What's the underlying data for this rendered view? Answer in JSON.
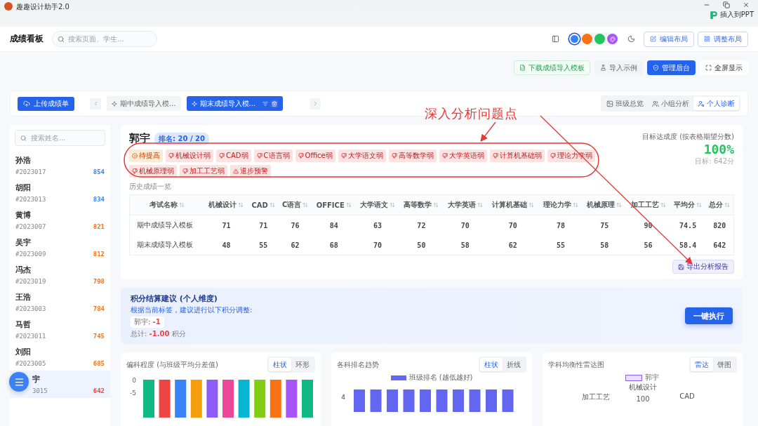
{
  "window": {
    "title": "趣趣设计助手2.0",
    "action": "插入到PPT"
  },
  "header": {
    "title": "成绩看板",
    "search": {
      "placeholder": "搜索页面、学生..."
    },
    "color_swatches": [
      {
        "color": "#3b82f6",
        "selected": true
      },
      {
        "color": "#f97316",
        "selected": false
      },
      {
        "color": "#22c55e",
        "selected": false
      },
      {
        "color": "#a855f7",
        "selected": false
      }
    ],
    "buttons": [
      {
        "label": "编辑布局",
        "kind": "edit"
      },
      {
        "label": "调整布局",
        "kind": "layout"
      }
    ]
  },
  "toolbar": [
    {
      "label": "下载成绩导入模板",
      "kind": "download"
    },
    {
      "label": "导入示例",
      "kind": "example"
    },
    {
      "label": "管理后台",
      "kind": "admin"
    },
    {
      "label": "全屏显示",
      "kind": "fullscreen"
    }
  ],
  "exam_bar": {
    "upload": "上传成绩单",
    "exams": [
      {
        "label": "期中成绩导入模...",
        "selected": false
      },
      {
        "label": "期末成绩导入模...",
        "selected": true
      }
    ],
    "views": [
      {
        "label": "班级总览",
        "kind": "class",
        "selected": false
      },
      {
        "label": "小组分析",
        "kind": "group",
        "selected": false
      },
      {
        "label": "个人诊断",
        "kind": "person",
        "selected": true
      }
    ]
  },
  "sidebar": {
    "search": {
      "placeholder": "搜索姓名..."
    },
    "students": [
      {
        "name": "孙浩",
        "id": "#2023017",
        "score": "854",
        "color": "#3b82f6",
        "selected": false
      },
      {
        "name": "胡阳",
        "id": "#2023013",
        "score": "834",
        "color": "#3b82f6",
        "selected": false
      },
      {
        "name": "黄博",
        "id": "#2023007",
        "score": "821",
        "color": "#f97316",
        "selected": false
      },
      {
        "name": "吴宇",
        "id": "#2023009",
        "score": "812",
        "color": "#f97316",
        "selected": false
      },
      {
        "name": "冯杰",
        "id": "#2023019",
        "score": "798",
        "color": "#f97316",
        "selected": false
      },
      {
        "name": "王浩",
        "id": "#2023003",
        "score": "784",
        "color": "#f97316",
        "selected": false
      },
      {
        "name": "马哲",
        "id": "#2023011",
        "score": "745",
        "color": "#f97316",
        "selected": false
      },
      {
        "name": "刘阳",
        "id": "#2023005",
        "score": "685",
        "color": "#f97316",
        "selected": false
      },
      {
        "name": "宇",
        "id": "3015",
        "score": "642",
        "color": "#ef4444",
        "selected": true
      }
    ]
  },
  "student": {
    "name": "郭宇",
    "rank": "排名: 20 / 20",
    "tags": [
      {
        "label": "待提高",
        "kind": "pending"
      },
      {
        "label": "机械设计弱",
        "kind": "weak"
      },
      {
        "label": "CAD弱",
        "kind": "weak"
      },
      {
        "label": "C语言弱",
        "kind": "weak"
      },
      {
        "label": "Office弱",
        "kind": "weak"
      },
      {
        "label": "大学语文弱",
        "kind": "weak"
      },
      {
        "label": "高等数学弱",
        "kind": "weak"
      },
      {
        "label": "大学英语弱",
        "kind": "weak"
      },
      {
        "label": "计算机基础弱",
        "kind": "weak"
      },
      {
        "label": "理论力学弱",
        "kind": "weak"
      },
      {
        "label": "机械原理弱",
        "kind": "weak"
      },
      {
        "label": "加工工艺弱",
        "kind": "weak"
      },
      {
        "label": "退步预警",
        "kind": "warning"
      }
    ],
    "history_title": "历史成绩一览",
    "columns": [
      "考试名称",
      "机械设计",
      "CAD",
      "C语言",
      "OFFICE",
      "大学语文",
      "高等数学",
      "大学英语",
      "计算机基础",
      "理论力学",
      "机械原理",
      "加工工艺",
      "平均分",
      "总分"
    ],
    "rows": [
      [
        "期中成绩导入模板",
        "71",
        "71",
        "76",
        "84",
        "63",
        "72",
        "70",
        "70",
        "78",
        "75",
        "90",
        "74.5",
        "820"
      ],
      [
        "期末成绩导入模板",
        "48",
        "55",
        "62",
        "68",
        "70",
        "50",
        "58",
        "62",
        "55",
        "58",
        "56",
        "58.4",
        "642"
      ]
    ],
    "target": {
      "label": "目标达成度 (按表格期望分数)",
      "value": "100%",
      "note": "目标: 642分"
    },
    "export": "导出分析报告"
  },
  "suggestion": {
    "title": "积分结算建议 (个人维度)",
    "subtitle": "根据当前标签，建议进行以下积分调整:",
    "chips": [
      {
        "name": "郭宇:",
        "delta": "-1"
      }
    ],
    "total_label": "总计:",
    "total": "-1.00",
    "unit": "积分",
    "action": "一键执行"
  },
  "charts": [
    {
      "kind": "deviation",
      "title": "偏科程度 (与班级平均分差值)",
      "toggle": [
        {
          "label": "柱状",
          "selected": true
        },
        {
          "label": "环形",
          "selected": false
        }
      ],
      "ticks": [
        "0",
        "-5"
      ]
    },
    {
      "kind": "rank",
      "title": "各科排名趋势",
      "toggle": [
        {
          "label": "柱状",
          "selected": true
        },
        {
          "label": "折线",
          "selected": false
        }
      ],
      "legend": "班级排名 (越低越好)",
      "ticks": [
        "4"
      ]
    },
    {
      "kind": "radar",
      "title": "学科均衡性雷达图",
      "toggle": [
        {
          "label": "雷达",
          "selected": true
        },
        {
          "label": "饼图",
          "selected": false
        }
      ],
      "legend": "郭宇",
      "labels": [
        "机械设计",
        "加工工艺",
        "100",
        "CAD"
      ]
    }
  ],
  "annotation": {
    "text": "深入分析问题点"
  }
}
